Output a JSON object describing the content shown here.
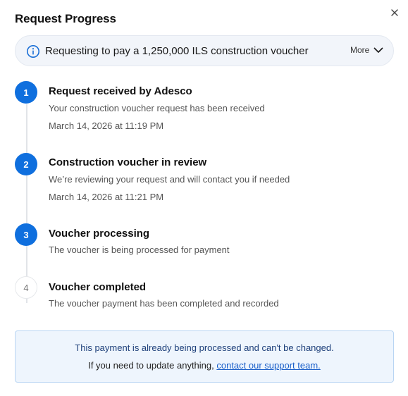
{
  "dialog": {
    "title": "Request Progress",
    "close_icon": "close-icon"
  },
  "info_bar": {
    "icon": "info-icon",
    "text": "Requesting to pay a 1,250,000 ILS construction voucher",
    "more_label": "More",
    "more_icon": "chevron-down-icon"
  },
  "steps": [
    {
      "number": "1",
      "status": "active",
      "title": "Request received by Adesco",
      "description": "Your construction voucher request has been received",
      "date": "March 14, 2026 at 11:19 PM"
    },
    {
      "number": "2",
      "status": "active",
      "title": "Construction voucher in review",
      "description": "We’re reviewing your request and will contact you if needed",
      "date": "March 14, 2026 at 11:21 PM"
    },
    {
      "number": "3",
      "status": "active",
      "title": "Voucher processing",
      "description": "The voucher is being processed for payment"
    },
    {
      "number": "4",
      "status": "pending",
      "title": "Voucher completed",
      "description": "The voucher payment has been completed and recorded"
    }
  ],
  "notice": {
    "main_text": "This payment is already being processed and can't be changed.",
    "sub_text_prefix": "If you need to update anything, ",
    "link_text": "contact our support team."
  },
  "colors": {
    "accent": "#0f6fde",
    "notice_bg": "#eef5fd",
    "notice_border": "#b9d5f3",
    "link": "#1a5fc9"
  }
}
